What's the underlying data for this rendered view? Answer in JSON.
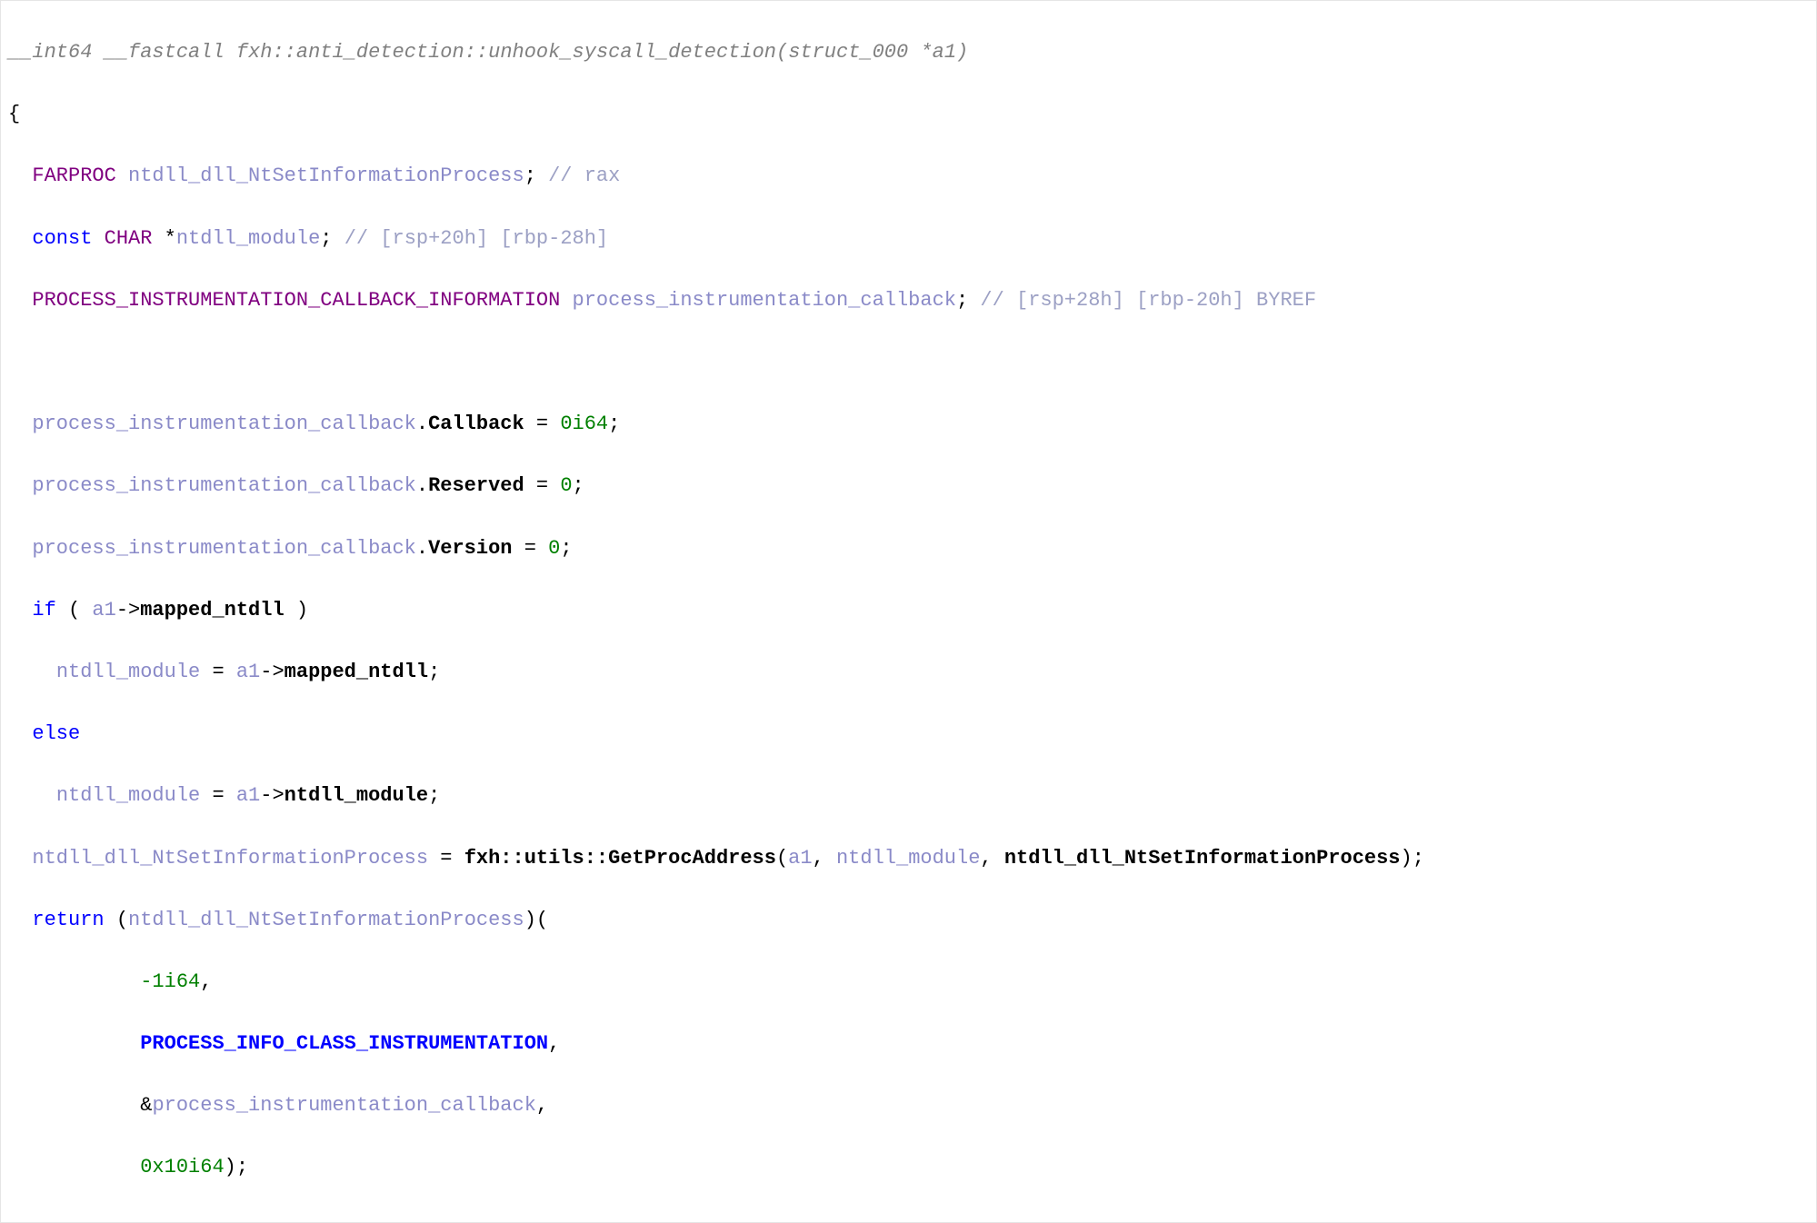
{
  "signature": {
    "ret_kw": "__int64",
    "call_kw": "__fastcall",
    "ns1": "fxh",
    "ns2": "anti_detection",
    "fn": "unhook_syscall_detection",
    "arg_type": "struct_000",
    "arg_name": "a1"
  },
  "decl1": {
    "type": "FARPROC",
    "name": "ntdll_dll_NtSetInformationProcess",
    "cmt": "// rax"
  },
  "decl2": {
    "kw": "const",
    "type": "CHAR",
    "name": "ntdll_module",
    "cmt": "// [rsp+20h] [rbp-28h]"
  },
  "decl3": {
    "type": "PROCESS_INSTRUMENTATION_CALLBACK_INFORMATION",
    "name": "process_instrumentation_callback",
    "cmt": "// [rsp+28h] [rbp-20h] BYREF"
  },
  "stmt1": {
    "obj": "process_instrumentation_callback",
    "mem": "Callback",
    "val": "0i64"
  },
  "stmt2": {
    "obj": "process_instrumentation_callback",
    "mem": "Reserved",
    "val": "0"
  },
  "stmt3": {
    "obj": "process_instrumentation_callback",
    "mem": "Version",
    "val": "0"
  },
  "ifline": {
    "kw": "if",
    "arg": "a1",
    "mem": "mapped_ntdll"
  },
  "thenline": {
    "lhs": "ntdll_module",
    "arg": "a1",
    "mem": "mapped_ntdll"
  },
  "elsekw": "else",
  "elseline": {
    "lhs": "ntdll_module",
    "arg": "a1",
    "mem": "ntdll_module"
  },
  "call": {
    "lhs": "ntdll_dll_NtSetInformationProcess",
    "ns1": "fxh",
    "ns2": "utils",
    "fn": "GetProcAddress",
    "a1": "a1",
    "a2": "ntdll_module",
    "a3": "ntdll_dll_NtSetInformationProcess"
  },
  "ret": {
    "kw": "return",
    "callee": "ntdll_dll_NtSetInformationProcess",
    "arg1": "-1i64",
    "arg2": "PROCESS_INFO_CLASS_INSTRUMENTATION",
    "arg3": "process_instrumentation_callback",
    "arg4": "0x10i64"
  }
}
